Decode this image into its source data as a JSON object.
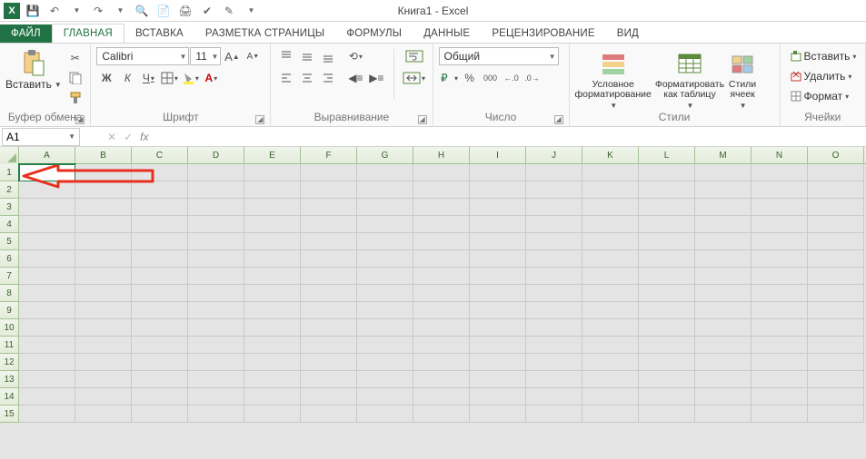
{
  "title": "Книга1 - Excel",
  "qat": {
    "app": "X",
    "tips": {
      "save": "💾",
      "undo": "↶",
      "redo": "↷",
      "preview": "🔍",
      "setup": "📄",
      "print": "🖨",
      "spell": "✔",
      "mode": "✎"
    }
  },
  "tabs": {
    "file": "ФАЙЛ",
    "home": "ГЛАВНАЯ",
    "insert": "ВСТАВКА",
    "layout": "РАЗМЕТКА СТРАНИЦЫ",
    "formulas": "ФОРМУЛЫ",
    "data": "ДАННЫЕ",
    "review": "РЕЦЕНЗИРОВАНИЕ",
    "view": "ВИД"
  },
  "ribbon": {
    "clipboard": {
      "paste": "Вставить",
      "label": "Буфер обмена"
    },
    "font": {
      "name": "Calibri",
      "size": "11",
      "label": "Шрифт",
      "bold": "Ж",
      "italic": "К",
      "underline": "Ч"
    },
    "align": {
      "label": "Выравнивание"
    },
    "number": {
      "format": "Общий",
      "label": "Число",
      "percent": "%",
      "comma": "000"
    },
    "styles": {
      "cond": "Условное\nформатирование",
      "table": "Форматировать\nкак таблицу",
      "cell": "Стили\nячеек",
      "label": "Стили"
    },
    "cells": {
      "insert": "Вставить",
      "delete": "Удалить",
      "format": "Формат",
      "label": "Ячейки"
    }
  },
  "namebox": "A1",
  "columns": [
    "A",
    "B",
    "C",
    "D",
    "E",
    "F",
    "G",
    "H",
    "I",
    "J",
    "K",
    "L",
    "M",
    "N",
    "O"
  ],
  "rows": [
    "1",
    "2",
    "3",
    "4",
    "5",
    "6",
    "7",
    "8",
    "9",
    "10",
    "11",
    "12",
    "13",
    "14",
    "15"
  ]
}
